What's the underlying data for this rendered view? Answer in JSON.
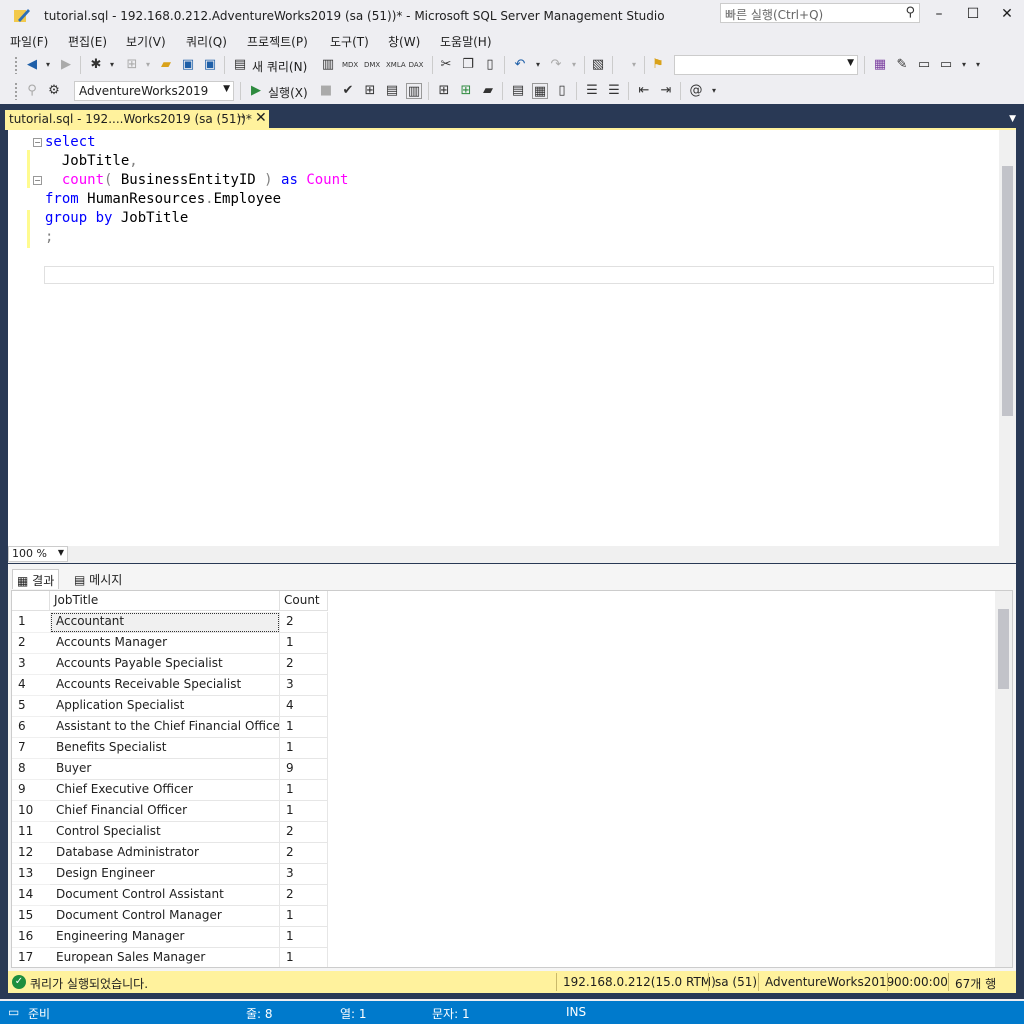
{
  "window": {
    "title": "tutorial.sql - 192.168.0.212.AdventureWorks2019 (sa (51))* - Microsoft SQL Server Management Studio",
    "quick_launch_placeholder": "빠른 실행(Ctrl+Q)"
  },
  "menu": [
    "파일(F)",
    "편집(E)",
    "보기(V)",
    "쿼리(Q)",
    "프로젝트(P)",
    "도구(T)",
    "창(W)",
    "도움말(H)"
  ],
  "toolbar": {
    "new_query_label": "새 쿼리(N)",
    "database": "AdventureWorks2019",
    "execute_label": "실행(X)",
    "mode_labels": [
      "MDX",
      "DMX",
      "XMLA",
      "DAX"
    ]
  },
  "document_tab": {
    "label": "tutorial.sql - 192....Works2019 (sa (51))*"
  },
  "editor": {
    "zoom": "100 %",
    "lines": [
      [
        {
          "t": "select",
          "c": "kw"
        }
      ],
      [
        {
          "t": "  JobTitle",
          "c": "id"
        },
        {
          "t": ",",
          "c": "gr"
        }
      ],
      [
        {
          "t": "  ",
          "c": "id"
        },
        {
          "t": "count",
          "c": "fn"
        },
        {
          "t": "( ",
          "c": "gr"
        },
        {
          "t": "BusinessEntityID",
          "c": "id"
        },
        {
          "t": " ) ",
          "c": "gr"
        },
        {
          "t": "as",
          "c": "kw"
        },
        {
          "t": " ",
          "c": "id"
        },
        {
          "t": "Count",
          "c": "fn"
        }
      ],
      [
        {
          "t": "from",
          "c": "kw"
        },
        {
          "t": " HumanResources",
          "c": "id"
        },
        {
          "t": ".",
          "c": "gr"
        },
        {
          "t": "Employee",
          "c": "id"
        }
      ],
      [
        {
          "t": "group",
          "c": "kw"
        },
        {
          "t": " ",
          "c": "id"
        },
        {
          "t": "by",
          "c": "kw"
        },
        {
          "t": " JobTitle",
          "c": "id"
        }
      ],
      [
        {
          "t": ";",
          "c": "gr"
        }
      ]
    ]
  },
  "results": {
    "tabs": [
      "결과",
      "메시지"
    ],
    "columns": [
      "JobTitle",
      "Count"
    ],
    "rows": [
      [
        "1",
        "Accountant",
        "2"
      ],
      [
        "2",
        "Accounts Manager",
        "1"
      ],
      [
        "3",
        "Accounts Payable Specialist",
        "2"
      ],
      [
        "4",
        "Accounts Receivable Specialist",
        "3"
      ],
      [
        "5",
        "Application Specialist",
        "4"
      ],
      [
        "6",
        "Assistant to the Chief Financial Officer",
        "1"
      ],
      [
        "7",
        "Benefits Specialist",
        "1"
      ],
      [
        "8",
        "Buyer",
        "9"
      ],
      [
        "9",
        "Chief Executive Officer",
        "1"
      ],
      [
        "10",
        "Chief Financial Officer",
        "1"
      ],
      [
        "11",
        "Control Specialist",
        "2"
      ],
      [
        "12",
        "Database Administrator",
        "2"
      ],
      [
        "13",
        "Design Engineer",
        "3"
      ],
      [
        "14",
        "Document Control Assistant",
        "2"
      ],
      [
        "15",
        "Document Control Manager",
        "1"
      ],
      [
        "16",
        "Engineering Manager",
        "1"
      ],
      [
        "17",
        "European Sales Manager",
        "1"
      ]
    ]
  },
  "exec_status": {
    "message": "쿼리가 실행되었습니다.",
    "server": "192.168.0.212(15.0 RTM)",
    "user": "sa (51)",
    "database": "AdventureWorks2019",
    "elapsed": "00:00:00",
    "row_count": "67개 행"
  },
  "statusbar": {
    "state": "준비",
    "line": "줄: 8",
    "col": "열: 1",
    "char": "문자: 1",
    "mode": "INS"
  },
  "colors": {
    "accent": "#007acc",
    "doc_tab": "#fff29d",
    "keyword": "#0000ff",
    "function": "#ff00ff"
  }
}
